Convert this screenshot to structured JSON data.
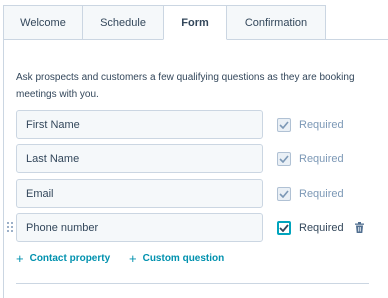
{
  "tabs": [
    {
      "label": "Welcome",
      "active": false
    },
    {
      "label": "Schedule",
      "active": false
    },
    {
      "label": "Form",
      "active": true
    },
    {
      "label": "Confirmation",
      "active": false
    }
  ],
  "form": {
    "description": "Ask prospects and customers a few qualifying questions as they are booking meetings with you.",
    "fields": [
      {
        "label": "First Name",
        "required_label": "Required",
        "required": true,
        "editable": false
      },
      {
        "label": "Last Name",
        "required_label": "Required",
        "required": true,
        "editable": false
      },
      {
        "label": "Email",
        "required_label": "Required",
        "required": true,
        "editable": false
      },
      {
        "label": "Phone number",
        "required_label": "Required",
        "required": true,
        "editable": true
      }
    ],
    "actions": {
      "contact_property": "Contact property",
      "custom_question": "Custom question"
    }
  },
  "colors": {
    "accent": "#00a4bd",
    "link": "#0091ae",
    "text": "#33475b",
    "muted": "#7c98b6",
    "border": "#cbd6e2",
    "field_bg": "#f5f8fa"
  },
  "icons": {
    "checkbox": "check-icon",
    "delete": "trash-icon",
    "drag": "drag-handle-icon",
    "add": "plus-icon"
  }
}
